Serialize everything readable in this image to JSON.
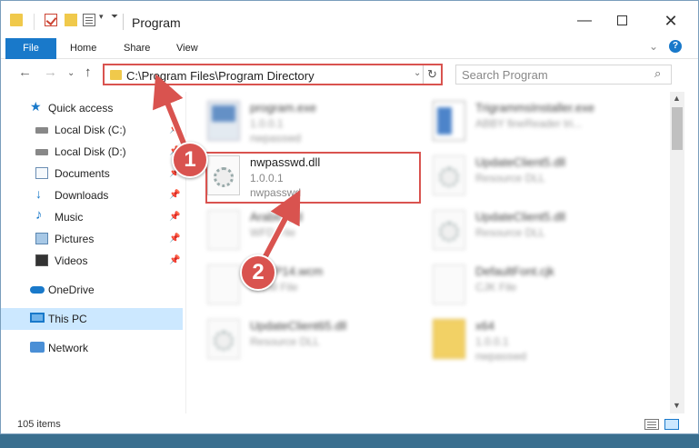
{
  "window": {
    "title": "Program",
    "min_symbol": "—",
    "close_symbol": "✕"
  },
  "quick_access_toolbar": {
    "dropdown_symbol": "▾",
    "customize_symbol": "⏷"
  },
  "ribbon": {
    "tabs": [
      "File",
      "Home",
      "Share",
      "View"
    ],
    "collapse_symbol": "⌄",
    "help_symbol": "?"
  },
  "navigation": {
    "back_symbol": "←",
    "forward_symbol": "→",
    "recent_symbol": "⌄",
    "up_symbol": "↑",
    "address": "C:\\Program Files\\Program Directory",
    "address_dropdown_symbol": "⌄",
    "refresh_symbol": "↻",
    "search_placeholder": "Search Program",
    "search_symbol": "⌕"
  },
  "sidebar": {
    "pin_symbol": "📌",
    "items": [
      {
        "label": "Quick access",
        "icon": "star-icon",
        "pinned": false
      },
      {
        "label": "Local Disk (C:)",
        "icon": "drive-icon",
        "pinned": true
      },
      {
        "label": "Local Disk (D:)",
        "icon": "drive-icon",
        "pinned": true
      },
      {
        "label": "Documents",
        "icon": "documents-icon",
        "pinned": true
      },
      {
        "label": "Downloads",
        "icon": "download-icon",
        "pinned": true
      },
      {
        "label": "Music",
        "icon": "music-icon",
        "pinned": true
      },
      {
        "label": "Pictures",
        "icon": "pictures-icon",
        "pinned": true
      },
      {
        "label": "Videos",
        "icon": "video-icon",
        "pinned": true
      },
      {
        "label": "OneDrive",
        "icon": "cloud-icon",
        "pinned": false
      },
      {
        "label": "This PC",
        "icon": "computer-icon",
        "pinned": false,
        "selected": true
      },
      {
        "label": "Network",
        "icon": "network-icon",
        "pinned": false
      }
    ]
  },
  "files": [
    {
      "name": "program.exe",
      "line2": "1.0.0.1",
      "line3": "nwpasswd",
      "icon": "exe-icon",
      "blurred": true
    },
    {
      "name": "TrigrammsInstaller.exe",
      "line2": "ABBY fineReader tri...",
      "line3": "",
      "icon": "installer-icon",
      "blurred": true
    },
    {
      "name": "nwpasswd.dll",
      "line2": "1.0.0.1",
      "line3": "nwpasswd",
      "icon": "dll-icon",
      "blurred": false
    },
    {
      "name": "UpdateClient5.dll",
      "line2": "Resource DLL",
      "line3": "",
      "icon": "dll-icon",
      "blurred": true
    },
    {
      "name": "Arabic.cfd",
      "line2": "WFD File",
      "line3": "",
      "icon": "file-icon",
      "blurred": true
    },
    {
      "name": "UpdateClient5.dll",
      "line2": "Resource DLL",
      "line3": "",
      "icon": "dll-icon",
      "blurred": true
    },
    {
      "name": "ooWP14.wcm",
      "line2": "WCM File",
      "line3": "",
      "icon": "file-icon",
      "blurred": true
    },
    {
      "name": "DefaultFont.cjk",
      "line2": "CJK File",
      "line3": "",
      "icon": "file-icon",
      "blurred": true
    },
    {
      "name": "UpdateClient65.dll",
      "line2": "Resource DLL",
      "line3": "",
      "icon": "dll-icon",
      "blurred": true
    },
    {
      "name": "x64",
      "line2": "1.0.0.1",
      "line3": "nwpasswd",
      "icon": "folder-icon",
      "blurred": true
    }
  ],
  "scrollbar": {
    "up_symbol": "▲",
    "down_symbol": "▼"
  },
  "status": {
    "item_count": "105 items"
  },
  "annotations": {
    "step1": "1",
    "step2": "2"
  },
  "colors": {
    "accent": "#1979ca",
    "highlight": "#d9534f",
    "selection": "#cce8ff"
  }
}
